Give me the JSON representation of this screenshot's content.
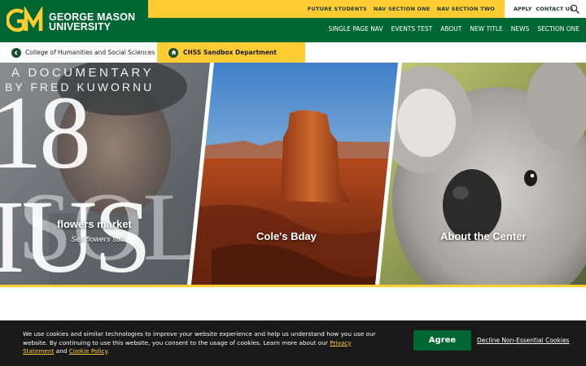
{
  "brand": {
    "logo_line1": "GEORGE MASON",
    "logo_line2": "UNIVERSITY",
    "green": "#006633",
    "gold": "#FFCC33"
  },
  "utility_nav": {
    "items": [
      "FUTURE STUDENTS",
      "NAV SECTION ONE",
      "NAV SECTION TWO"
    ],
    "right_items": [
      "APPLY",
      "CONTACT US"
    ],
    "search_icon": "search-icon"
  },
  "main_nav": {
    "items": [
      "SINGLE PAGE NAV",
      "EVENTS TEST",
      "ABOUT",
      "NEW TITLE",
      "NEWS",
      "SECTION ONE"
    ]
  },
  "breadcrumb": {
    "college": "College of Humanities and Social Sciences",
    "college_icon": "chevron-left-icon",
    "department": "CHSS Sandbox Department",
    "department_icon": "home-icon"
  },
  "hero": {
    "panel1": {
      "title": "flowers market",
      "subtitle": "Sell flowers sub",
      "overlay_line1": "A DOCUMENTARY",
      "overlay_line2": "BY FRED KUWORNU",
      "big_text1": "18 IUS",
      "big_text2": "SOLI"
    },
    "panel2": {
      "title": "Cole's Bday"
    },
    "panel3": {
      "title": "About the Center"
    }
  },
  "cookie_banner": {
    "text_part1": "We use cookies and similar technologies to improve your website experience and help us understand how you use our website. By continuing to use this website, you consent to the usage of cookies. Learn more about our ",
    "privacy_link": "Privacy Statement",
    "text_part2": " and ",
    "cookie_link": "Cookie Policy",
    "text_part3": ".",
    "agree_label": "Agree",
    "decline_label": "Decline Non-Essential Cookies"
  }
}
